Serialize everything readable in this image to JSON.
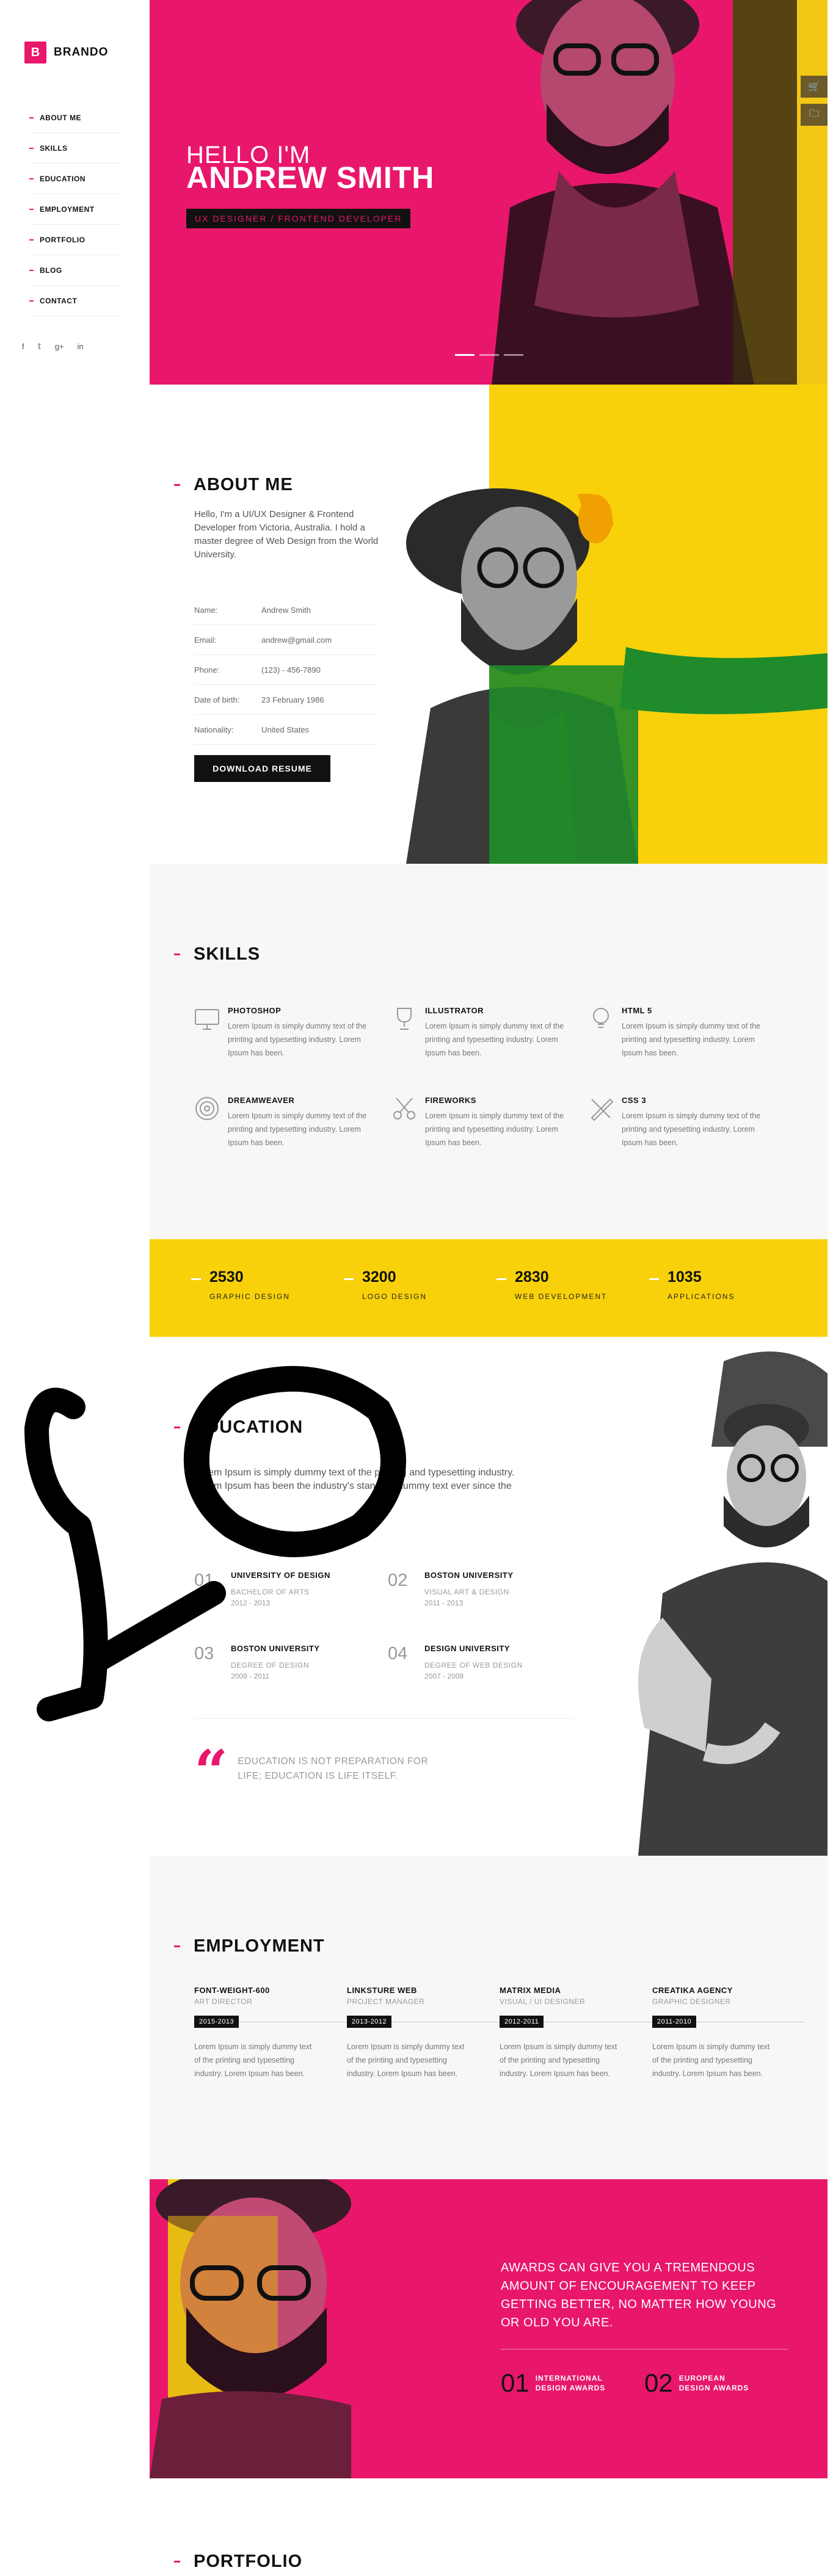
{
  "brand": {
    "mark": "B",
    "name": "BRANDO"
  },
  "nav": {
    "items": [
      {
        "label": "ABOUT ME"
      },
      {
        "label": "SKILLS"
      },
      {
        "label": "EDUCATION"
      },
      {
        "label": "EMPLOYMENT"
      },
      {
        "label": "PORTFOLIO"
      },
      {
        "label": "BLOG"
      },
      {
        "label": "CONTACT"
      }
    ]
  },
  "social": {
    "facebook": "f",
    "twitter": "𝕥",
    "google": "g+",
    "linkedin": "in"
  },
  "hero": {
    "greeting": "HELLO I'M",
    "name": "ANDREW SMITH",
    "tagline": "UX DESIGNER / FRONTEND DEVELOPER",
    "cart_icon": "🛒",
    "folder_icon": "🗀"
  },
  "about": {
    "title": "ABOUT ME",
    "intro": "Hello, I'm a UI/UX Designer & Frontend Developer from Victoria, Australia. I hold a master degree of Web Design from the World University.",
    "info": [
      {
        "key": "Name:",
        "value": "Andrew Smith"
      },
      {
        "key": "Email:",
        "value": "andrew@gmail.com"
      },
      {
        "key": "Phone:",
        "value": "(123) - 456-7890"
      },
      {
        "key": "Date of birth:",
        "value": "23 February 1986"
      },
      {
        "key": "Nationality:",
        "value": "United States"
      }
    ],
    "download_label": "DOWNLOAD RESUME"
  },
  "skills": {
    "title": "SKILLS",
    "items": [
      {
        "name": "PHOTOSHOP",
        "desc": "Lorem Ipsum is simply dummy text of the printing and typesetting industry. Lorem Ipsum has been."
      },
      {
        "name": "ILLUSTRATOR",
        "desc": "Lorem Ipsum is simply dummy text of the printing and typesetting industry. Lorem Ipsum has been."
      },
      {
        "name": "HTML 5",
        "desc": "Lorem Ipsum is simply dummy text of the printing and typesetting industry. Lorem Ipsum has been."
      },
      {
        "name": "DREAMWEAVER",
        "desc": "Lorem Ipsum is simply dummy text of the printing and typesetting industry. Lorem Ipsum has been."
      },
      {
        "name": "FIREWORKS",
        "desc": "Lorem Ipsum is simply dummy text of the printing and typesetting industry. Lorem Ipsum has been."
      },
      {
        "name": "CSS 3",
        "desc": "Lorem Ipsum is simply dummy text of the printing and typesetting industry. Lorem Ipsum has been."
      }
    ]
  },
  "stats": [
    {
      "value": "2530",
      "label": "GRAPHIC DESIGN"
    },
    {
      "value": "3200",
      "label": "LOGO DESIGN"
    },
    {
      "value": "2830",
      "label": "WEB DEVELOPMENT"
    },
    {
      "value": "1035",
      "label": "APPLICATIONS"
    }
  ],
  "education": {
    "title": "EDUCATION",
    "intro": "Lorem Ipsum is simply dummy text of the printing and typesetting industry. Lorem Ipsum has been the industry's standard dummy text ever since the 1500s.",
    "items": [
      {
        "num": "01",
        "school": "UNIVERSITY OF DESIGN",
        "degree": "BACHELOR OF ARTS",
        "years": "2012 - 2013"
      },
      {
        "num": "02",
        "school": "BOSTON UNIVERSITY",
        "degree": "VISUAL ART & DESIGN",
        "years": "2011 - 2013"
      },
      {
        "num": "03",
        "school": "BOSTON UNIVERSITY",
        "degree": "DEGREE OF DESIGN",
        "years": "2009 - 2011"
      },
      {
        "num": "04",
        "school": "DESIGN UNIVERSITY",
        "degree": "DEGREE OF WEB DESIGN",
        "years": "2007 - 2009"
      }
    ],
    "quote": "EDUCATION IS NOT PREPARATION FOR LIFE; EDUCATION IS LIFE ITSELF."
  },
  "employment": {
    "title": "EMPLOYMENT",
    "items": [
      {
        "company": "FONT-WEIGHT-600",
        "role": "ART DIRECTOR",
        "years": "2015-2013",
        "desc": "Lorem Ipsum is simply dummy text of the printing and typesetting industry. Lorem Ipsum has been."
      },
      {
        "company": "LINKSTURE WEB",
        "role": "PROJECT MANAGER",
        "years": "2013-2012",
        "desc": "Lorem Ipsum is simply dummy text of the printing and typesetting industry. Lorem Ipsum has been."
      },
      {
        "company": "MATRIX MEDIA",
        "role": "VISUAL / UI DESIGNER",
        "years": "2012-2011",
        "desc": "Lorem Ipsum is simply dummy text of the printing and typesetting industry. Lorem Ipsum has been."
      },
      {
        "company": "CREATIKA AGENCY",
        "role": "GRAPHIC DESIGNER",
        "years": "2011-2010",
        "desc": "Lorem Ipsum is simply dummy text of the printing and typesetting industry. Lorem Ipsum has been."
      }
    ]
  },
  "awards": {
    "quote": "AWARDS CAN GIVE YOU A TREMENDOUS AMOUNT OF ENCOURAGEMENT TO KEEP GETTING BETTER, NO MATTER HOW YOUNG OR OLD YOU ARE.",
    "items": [
      {
        "num": "01",
        "line1": "INTERNATIONAL",
        "line2": "DESIGN AWARDS"
      },
      {
        "num": "02",
        "line1": "EUROPEAN",
        "line2": "DESIGN AWARDS"
      }
    ]
  },
  "portfolio": {
    "title": "PORTFOLIO"
  },
  "colors": {
    "accent": "#e8176b",
    "yellow": "#f8d10a",
    "dark": "#111111",
    "light_bg": "#f7f7f7"
  }
}
